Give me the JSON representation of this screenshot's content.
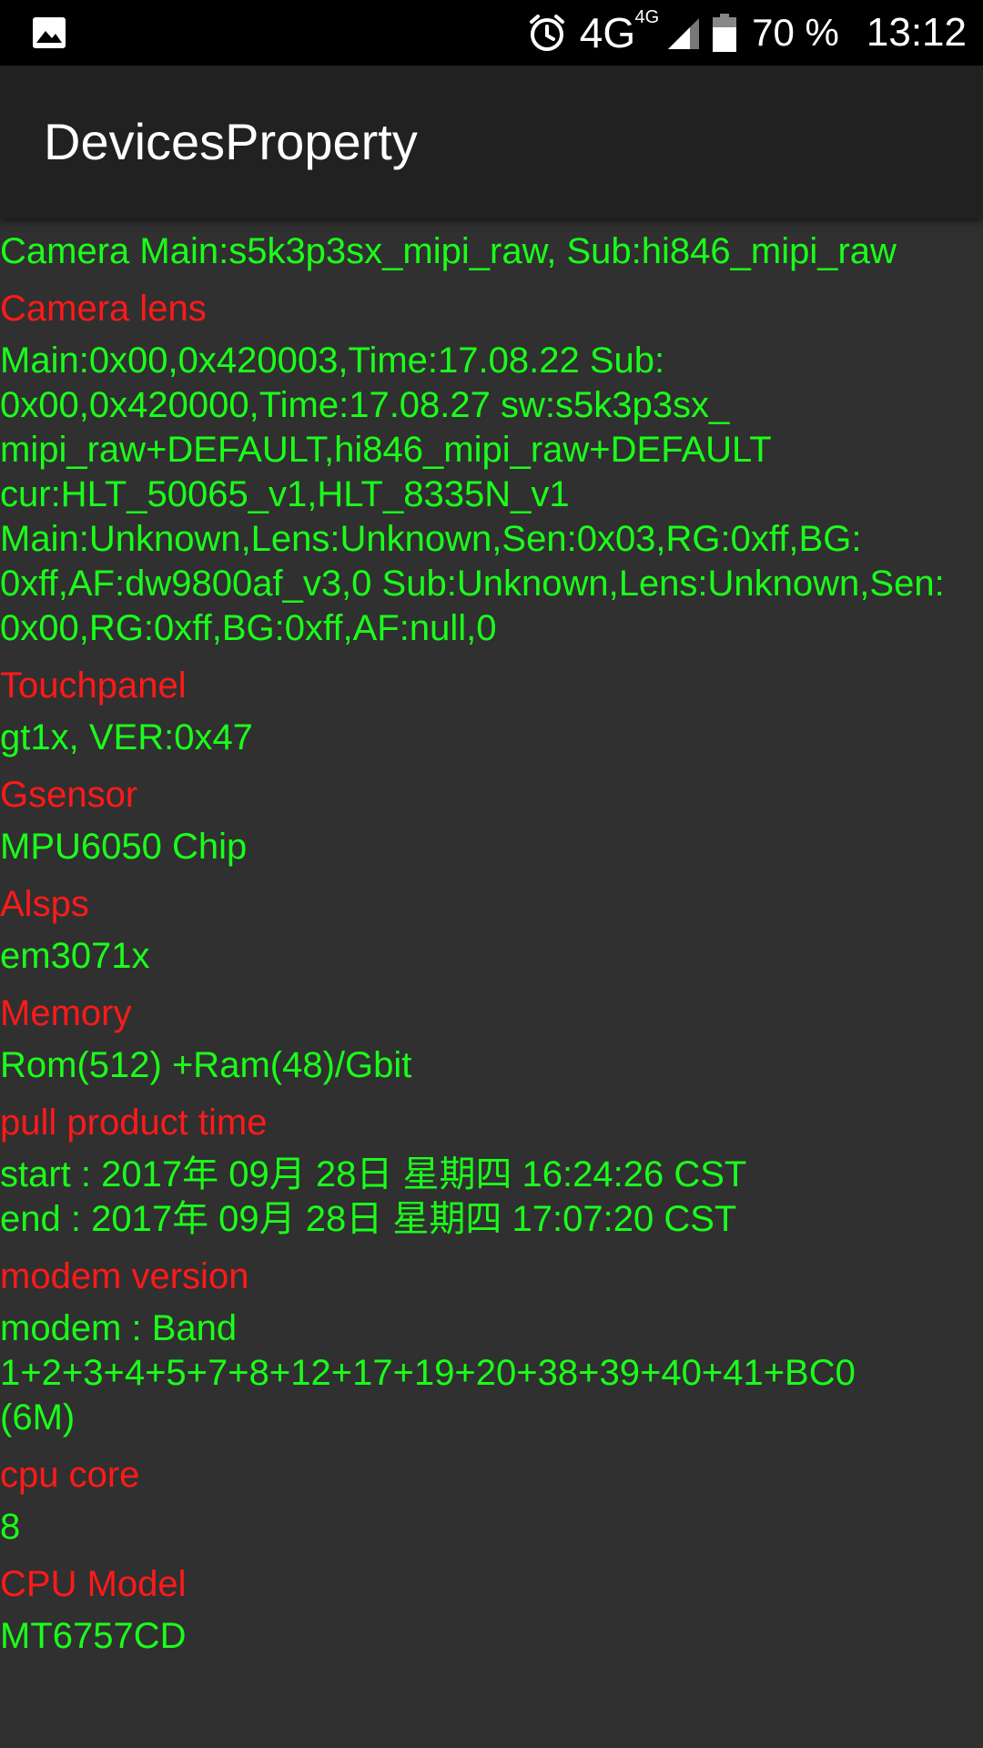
{
  "status_bar": {
    "left_icon": "image-icon",
    "alarm_icon": "alarm-clock-icon",
    "network": "4G",
    "network_small": "4G",
    "signal_icon": "cell-signal-icon",
    "battery_icon": "battery-icon",
    "battery": "70 %",
    "time": "13:12"
  },
  "app_bar": {
    "title": "DevicesProperty"
  },
  "sections": {
    "camera": {
      "value": "Camera Main:s5k3p3sx_mipi_raw, Sub:hi846_mipi_raw"
    },
    "camera_lens": {
      "title": "Camera lens",
      "value": "Main:0x00,0x420003,Time:17.08.22  Sub:\n0x00,0x420000,Time:17.08.27  sw:s5k3p3sx_\nmipi_raw+DEFAULT,hi846_mipi_raw+DEFAULT\ncur:HLT_50065_v1,HLT_8335N_v1\nMain:Unknown,Lens:Unknown,Sen:0x03,RG:0xff,BG:\n0xff,AF:dw9800af_v3,0  Sub:Unknown,Lens:Unknown,Sen:\n0x00,RG:0xff,BG:0xff,AF:null,0"
    },
    "touchpanel": {
      "title": "Touchpanel",
      "value": "gt1x, VER:0x47"
    },
    "gsensor": {
      "title": "Gsensor",
      "value": "MPU6050 Chip"
    },
    "alsps": {
      "title": "Alsps",
      "value": "em3071x"
    },
    "memory": {
      "title": "Memory",
      "value": "Rom(512) +Ram(48)/Gbit"
    },
    "pull_product_time": {
      "title": "pull product time",
      "value": "start : 2017年 09月 28日 星期四 16:24:26 CST\nend : 2017年 09月 28日 星期四 17:07:20 CST"
    },
    "modem_version": {
      "title": "modem version",
      "value": "modem : Band\n1+2+3+4+5+7+8+12+17+19+20+38+39+40+41+BC0\n(6M)"
    },
    "cpu_core": {
      "title": "cpu core",
      "value": "8"
    },
    "cpu_model": {
      "title": "CPU Model",
      "value": "MT6757CD"
    }
  },
  "colors": {
    "title_color": "#ff1a1a",
    "value_color": "#1aff1a",
    "background": "#303030",
    "app_bar": "#212121",
    "status_bar": "#000000"
  }
}
